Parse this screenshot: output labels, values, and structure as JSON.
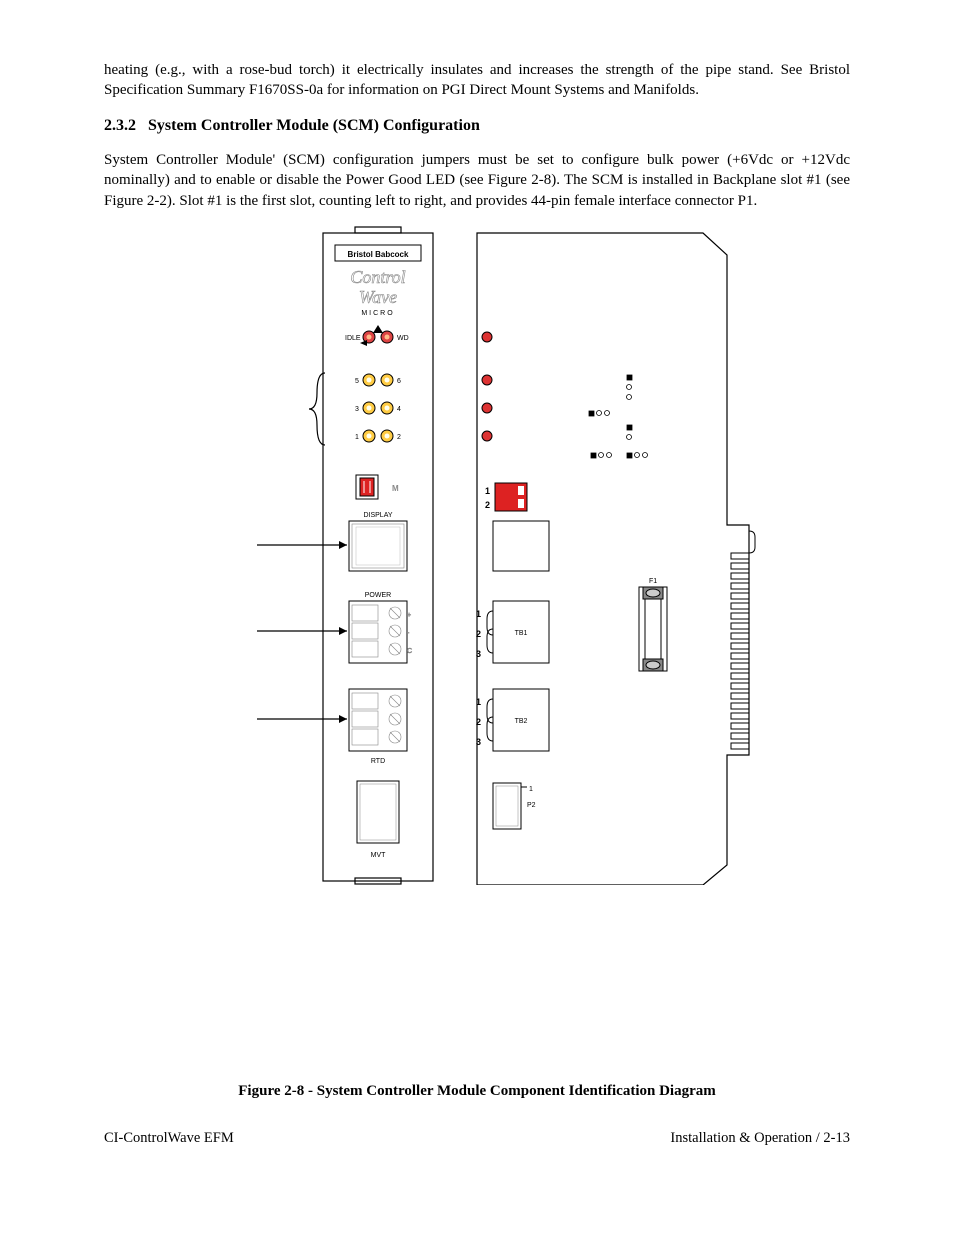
{
  "intro_paragraph": "heating (e.g., with a rose-bud torch) it electrically insulates and increases the strength of the pipe stand. See Bristol Specification Summary F1670SS-0a for information on PGI Direct Mount Systems and Manifolds.",
  "section": {
    "number": "2.3.2",
    "title": "System Controller Module (SCM) Configuration"
  },
  "body_paragraph": "System Controller Module' (SCM) configuration jumpers must be set to configure bulk power (+6Vdc or +12Vdc nominally) and to enable or disable the Power Good LED (see Figure 2-8). The SCM is installed in Backplane slot #1 (see Figure 2-2). Slot #1 is the first slot, counting left to right, and provides 44-pin female interface connector P1.",
  "figure": {
    "caption": "Figure 2-8 - System Controller Module Component Identification Diagram",
    "front_panel": {
      "brand_box": "Bristol Babcock",
      "logo_top": "Control",
      "logo_bottom": "Wave",
      "logo_sub": "MICRO",
      "idle": "IDLE",
      "wd": "WD",
      "status_leds": [
        "5",
        "6",
        "3",
        "4",
        "1",
        "2"
      ],
      "display_switch_label": "M",
      "display": "DISPLAY",
      "power": "POWER",
      "rtd": "RTD",
      "mvt": "MVT"
    },
    "pcb": {
      "jumper_block": [
        "1",
        "2"
      ],
      "tb1": {
        "label": "TB1",
        "pins": [
          "1",
          "2",
          "3"
        ]
      },
      "tb2": {
        "label": "TB2",
        "pins": [
          "1",
          "2",
          "3"
        ]
      },
      "fuse": "F1",
      "p2_label1": "1",
      "p2_label2": "P2"
    }
  },
  "footer": {
    "left": "CI-ControlWave EFM",
    "right": "Installation & Operation / 2-13"
  }
}
